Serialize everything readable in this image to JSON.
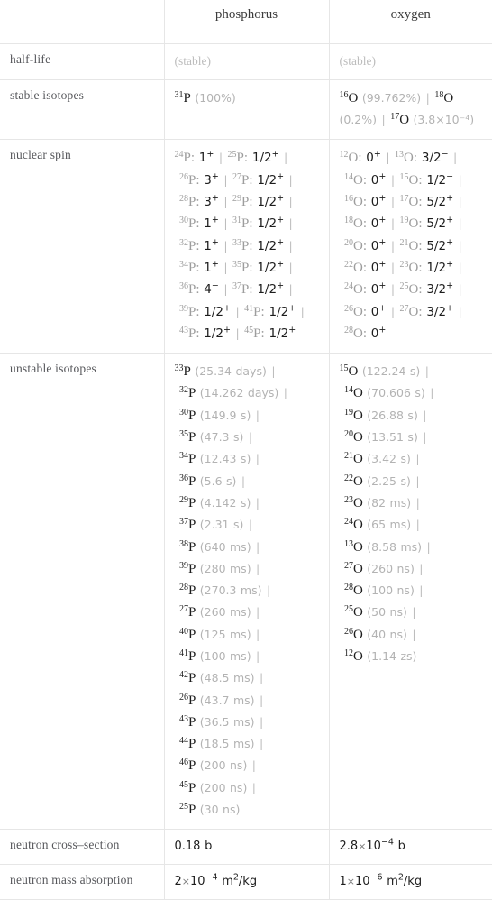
{
  "table": {
    "columns": [
      "",
      "phosphorus",
      "oxygen"
    ],
    "rows": [
      {
        "label": "half-life",
        "phosphorus": "(stable)",
        "oxygen": "(stable)"
      },
      {
        "label": "stable isotopes",
        "phosphorus_isotopes": [
          {
            "mass": "31",
            "symbol": "P",
            "value": "(100%)"
          }
        ],
        "oxygen_isotopes": [
          {
            "mass": "16",
            "symbol": "O",
            "value": "(99.762%)"
          },
          {
            "mass": "18",
            "symbol": "O",
            "value": "(0.2%)"
          },
          {
            "mass": "17",
            "symbol": "O",
            "value": "(3.8×10⁻⁴)"
          }
        ]
      },
      {
        "label": "nuclear spin",
        "phosphorus_spins": [
          {
            "mass": "24",
            "symbol": "P",
            "spin": "1",
            "sup": "+"
          },
          {
            "mass": "25",
            "symbol": "P",
            "spin": "1/2",
            "sup": "+"
          },
          {
            "mass": "26",
            "symbol": "P",
            "spin": "3",
            "sup": "+"
          },
          {
            "mass": "27",
            "symbol": "P",
            "spin": "1/2",
            "sup": "+"
          },
          {
            "mass": "28",
            "symbol": "P",
            "spin": "3",
            "sup": "+"
          },
          {
            "mass": "29",
            "symbol": "P",
            "spin": "1/2",
            "sup": "+"
          },
          {
            "mass": "30",
            "symbol": "P",
            "spin": "1",
            "sup": "+"
          },
          {
            "mass": "31",
            "symbol": "P",
            "spin": "1/2",
            "sup": "+"
          },
          {
            "mass": "32",
            "symbol": "P",
            "spin": "1",
            "sup": "+"
          },
          {
            "mass": "33",
            "symbol": "P",
            "spin": "1/2",
            "sup": "+"
          },
          {
            "mass": "34",
            "symbol": "P",
            "spin": "1",
            "sup": "+"
          },
          {
            "mass": "35",
            "symbol": "P",
            "spin": "1/2",
            "sup": "+"
          },
          {
            "mass": "36",
            "symbol": "P",
            "spin": "4",
            "sup": "−"
          },
          {
            "mass": "37",
            "symbol": "P",
            "spin": "1/2",
            "sup": "+"
          },
          {
            "mass": "39",
            "symbol": "P",
            "spin": "1/2",
            "sup": "+"
          },
          {
            "mass": "41",
            "symbol": "P",
            "spin": "1/2",
            "sup": "+"
          },
          {
            "mass": "43",
            "symbol": "P",
            "spin": "1/2",
            "sup": "+"
          },
          {
            "mass": "45",
            "symbol": "P",
            "spin": "1/2",
            "sup": "+"
          }
        ],
        "oxygen_spins": [
          {
            "mass": "12",
            "symbol": "O",
            "spin": "0",
            "sup": "+"
          },
          {
            "mass": "13",
            "symbol": "O",
            "spin": "3/2",
            "sup": "−"
          },
          {
            "mass": "14",
            "symbol": "O",
            "spin": "0",
            "sup": "+"
          },
          {
            "mass": "15",
            "symbol": "O",
            "spin": "1/2",
            "sup": "−"
          },
          {
            "mass": "16",
            "symbol": "O",
            "spin": "0",
            "sup": "+"
          },
          {
            "mass": "17",
            "symbol": "O",
            "spin": "5/2",
            "sup": "+"
          },
          {
            "mass": "18",
            "symbol": "O",
            "spin": "0",
            "sup": "+"
          },
          {
            "mass": "19",
            "symbol": "O",
            "spin": "5/2",
            "sup": "+"
          },
          {
            "mass": "20",
            "symbol": "O",
            "spin": "0",
            "sup": "+"
          },
          {
            "mass": "21",
            "symbol": "O",
            "spin": "5/2",
            "sup": "+"
          },
          {
            "mass": "22",
            "symbol": "O",
            "spin": "0",
            "sup": "+"
          },
          {
            "mass": "23",
            "symbol": "O",
            "spin": "1/2",
            "sup": "+"
          },
          {
            "mass": "24",
            "symbol": "O",
            "spin": "0",
            "sup": "+"
          },
          {
            "mass": "25",
            "symbol": "O",
            "spin": "3/2",
            "sup": "+"
          },
          {
            "mass": "26",
            "symbol": "O",
            "spin": "0",
            "sup": "+"
          },
          {
            "mass": "27",
            "symbol": "O",
            "spin": "3/2",
            "sup": "+"
          },
          {
            "mass": "28",
            "symbol": "O",
            "spin": "0",
            "sup": "+"
          }
        ]
      },
      {
        "label": "unstable isotopes",
        "phosphorus_unstable": [
          {
            "mass": "33",
            "symbol": "P",
            "value": "(25.34 days)"
          },
          {
            "mass": "32",
            "symbol": "P",
            "value": "(14.262 days)"
          },
          {
            "mass": "30",
            "symbol": "P",
            "value": "(149.9 s)"
          },
          {
            "mass": "35",
            "symbol": "P",
            "value": "(47.3 s)"
          },
          {
            "mass": "34",
            "symbol": "P",
            "value": "(12.43 s)"
          },
          {
            "mass": "36",
            "symbol": "P",
            "value": "(5.6 s)"
          },
          {
            "mass": "29",
            "symbol": "P",
            "value": "(4.142 s)"
          },
          {
            "mass": "37",
            "symbol": "P",
            "value": "(2.31 s)"
          },
          {
            "mass": "38",
            "symbol": "P",
            "value": "(640 ms)"
          },
          {
            "mass": "39",
            "symbol": "P",
            "value": "(280 ms)"
          },
          {
            "mass": "28",
            "symbol": "P",
            "value": "(270.3 ms)"
          },
          {
            "mass": "27",
            "symbol": "P",
            "value": "(260 ms)"
          },
          {
            "mass": "40",
            "symbol": "P",
            "value": "(125 ms)"
          },
          {
            "mass": "41",
            "symbol": "P",
            "value": "(100 ms)"
          },
          {
            "mass": "42",
            "symbol": "P",
            "value": "(48.5 ms)"
          },
          {
            "mass": "26",
            "symbol": "P",
            "value": "(43.7 ms)"
          },
          {
            "mass": "43",
            "symbol": "P",
            "value": "(36.5 ms)"
          },
          {
            "mass": "44",
            "symbol": "P",
            "value": "(18.5 ms)"
          },
          {
            "mass": "46",
            "symbol": "P",
            "value": "(200 ns)"
          },
          {
            "mass": "45",
            "symbol": "P",
            "value": "(200 ns)"
          },
          {
            "mass": "25",
            "symbol": "P",
            "value": "(30 ns)"
          }
        ],
        "oxygen_unstable": [
          {
            "mass": "15",
            "symbol": "O",
            "value": "(122.24 s)"
          },
          {
            "mass": "14",
            "symbol": "O",
            "value": "(70.606 s)"
          },
          {
            "mass": "19",
            "symbol": "O",
            "value": "(26.88 s)"
          },
          {
            "mass": "20",
            "symbol": "O",
            "value": "(13.51 s)"
          },
          {
            "mass": "21",
            "symbol": "O",
            "value": "(3.42 s)"
          },
          {
            "mass": "22",
            "symbol": "O",
            "value": "(2.25 s)"
          },
          {
            "mass": "23",
            "symbol": "O",
            "value": "(82 ms)"
          },
          {
            "mass": "24",
            "symbol": "O",
            "value": "(65 ms)"
          },
          {
            "mass": "13",
            "symbol": "O",
            "value": "(8.58 ms)"
          },
          {
            "mass": "27",
            "symbol": "O",
            "value": "(260 ns)"
          },
          {
            "mass": "28",
            "symbol": "O",
            "value": "(100 ns)"
          },
          {
            "mass": "25",
            "symbol": "O",
            "value": "(50 ns)"
          },
          {
            "mass": "26",
            "symbol": "O",
            "value": "(40 ns)"
          },
          {
            "mass": "12",
            "symbol": "O",
            "value": "(1.14 zs)"
          }
        ]
      },
      {
        "label": "neutron cross–section",
        "phosphorus": "0.18 b",
        "oxygen": "2.8×10⁻⁴ b"
      },
      {
        "label": "neutron mass absorption",
        "phosphorus": "2×10⁻⁴ m²/kg",
        "oxygen": "1×10⁻⁶ m²/kg"
      }
    ]
  },
  "labels": {
    "half_life": "half-life",
    "stable_isotopes": "stable isotopes",
    "nuclear_spin": "nuclear spin",
    "unstable_isotopes": "unstable isotopes",
    "neutron_cross_section": "neutron cross–section",
    "neutron_mass_absorption": "neutron mass absorption"
  },
  "header": {
    "col1": "phosphorus",
    "col2": "oxygen"
  },
  "halflife": {
    "phosphorus": "(stable)",
    "oxygen": "(stable)"
  },
  "cross_section": {
    "phosphorus_value": "0.18",
    "phosphorus_unit": "b",
    "oxygen_mantissa": "2.8",
    "oxygen_exp": "−4",
    "oxygen_unit": "b"
  },
  "mass_absorption": {
    "phosphorus_mantissa": "2",
    "phosphorus_exp": "−4",
    "phosphorus_unit": "m",
    "phosphorus_unit_exp": "2",
    "phosphorus_unit_den": "/kg",
    "oxygen_mantissa": "1",
    "oxygen_exp": "−6",
    "oxygen_unit": "m",
    "oxygen_unit_exp": "2",
    "oxygen_unit_den": "/kg"
  },
  "colors": {
    "border": "#e6e6e6",
    "label_text": "#55565a",
    "dark_text": "#1d1d1d",
    "muted_text": "#b3b3b3",
    "background": "#ffffff"
  }
}
